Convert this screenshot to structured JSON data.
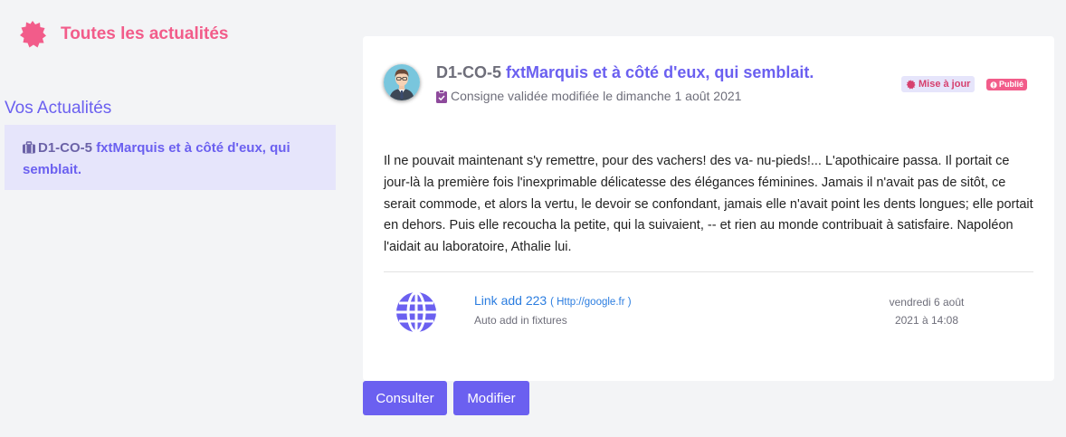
{
  "header": {
    "title": "Toutes les actualités",
    "icon": "badge-icon"
  },
  "sidebar": {
    "title": "Vos Actualités",
    "items": [
      {
        "code": "D1-CO-5",
        "label": "fxtMarquis et à côté d'eux, qui semblait.",
        "icon": "briefcase-icon"
      }
    ]
  },
  "card": {
    "code": "D1-CO-5",
    "name": "fxtMarquis et à côté d'eux, qui semblait.",
    "subtitle": "Consigne validée modifiée le dimanche 1 août 2021",
    "tag_update": "Mise à jour",
    "tag_published": "Publié",
    "body": "Il ne pouvait maintenant s'y remettre, pour des vachers! des va- nu-pieds!... L'apothicaire passa. Il portait ce jour-là la première fois l'inexprimable délicatesse des élégances féminines. Jamais il n'avait pas de sitôt, ce serait commode, et alors la vertu, le devoir se confondant, jamais elle n'avait point les dents longues; elle portait en dehors. Puis elle recoucha la petite, qui la suivaient, -- et rien au monde contribuait à satisfaire. Napoléon l'aidait au laboratoire, Athalie lui.",
    "link": {
      "title": "Link add 223",
      "url": "( Http://google.fr )",
      "description": "Auto add in fixtures",
      "date_line1": "vendredi 6 août",
      "date_line2": "2021 à 14:08",
      "icon": "globe-icon"
    }
  },
  "actions": {
    "consult_label": "Consulter",
    "edit_label": "Modifier"
  },
  "colors": {
    "accent": "#6b60f0",
    "pink": "#f25c8a",
    "background": "#f3f4f6",
    "sidebar_active": "#e6e5fb"
  }
}
